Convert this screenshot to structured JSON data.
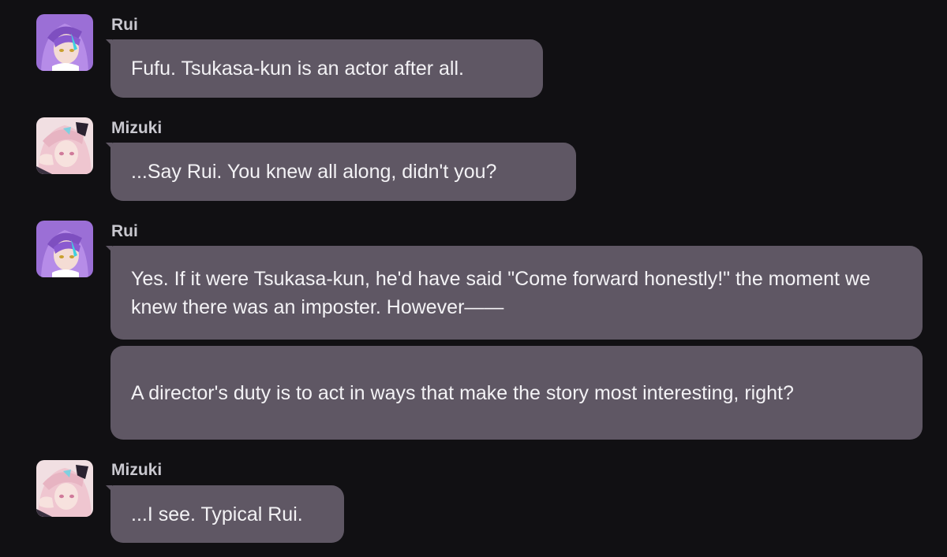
{
  "messages": [
    {
      "sender": "Rui",
      "avatar": "rui-avatar-icon",
      "texts": [
        "Fufu. Tsukasa-kun is an actor after all."
      ]
    },
    {
      "sender": "Mizuki",
      "avatar": "mizuki-avatar-icon",
      "texts": [
        "...Say Rui. You knew all along, didn't you?"
      ]
    },
    {
      "sender": "Rui",
      "avatar": "rui-avatar-icon",
      "texts": [
        "Yes. If it were Tsukasa-kun, he'd have said \"Come forward honestly!\" the moment we knew there was an imposter. However——",
        "A director's duty is to act in ways that make the story most interesting, right?"
      ]
    },
    {
      "sender": "Mizuki",
      "avatar": "mizuki-avatar-icon",
      "texts": [
        "...I see. Typical Rui."
      ]
    }
  ],
  "colors": {
    "background": "#111013",
    "bubble": "#5f5764",
    "sender_name": "#c9c8cf",
    "message_text": "#f3f2f5",
    "rui_accent": "#9b6fd6",
    "mizuki_accent": "#e9c4cf"
  }
}
